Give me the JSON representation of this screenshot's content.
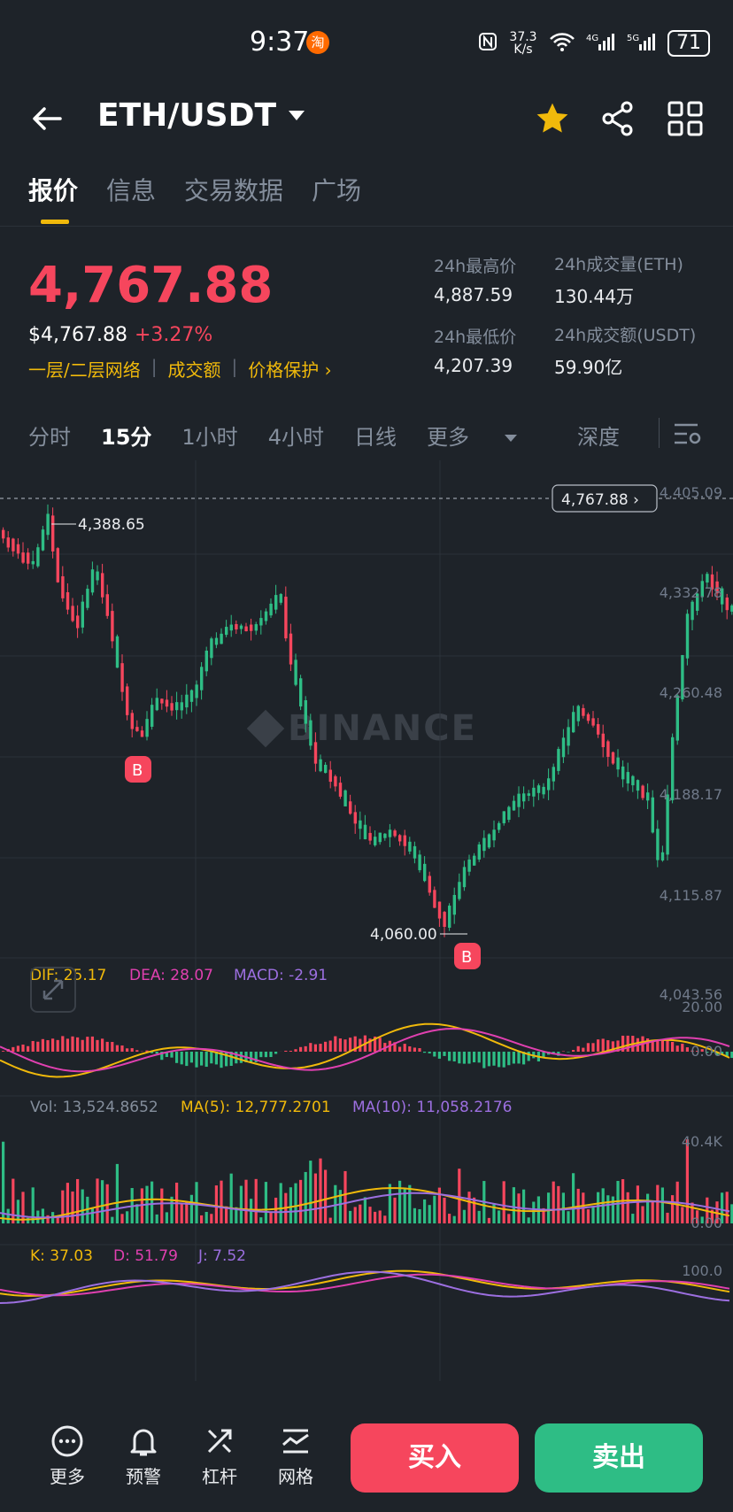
{
  "status_bar": {
    "time": "9:37",
    "net_speed": "37.3 K/s",
    "battery": "71",
    "app_badge": "淘"
  },
  "header": {
    "pair": "ETH/USDT",
    "icons": [
      "back-arrow-icon",
      "star-icon",
      "share-icon",
      "grid-menu-icon"
    ],
    "star_color": "#f0b90b"
  },
  "tabs": [
    {
      "label": "报价",
      "active": true
    },
    {
      "label": "信息"
    },
    {
      "label": "交易数据"
    },
    {
      "label": "广场"
    }
  ],
  "price": {
    "last": "4,767.88",
    "usd": "$4,767.88",
    "change": "+3.27%",
    "color": "#f6465d"
  },
  "links": {
    "network": "一层/二层网络",
    "volume": "成交额",
    "protection": "价格保护 ›"
  },
  "stats": {
    "high_label": "24h最高价",
    "high": "4,887.59",
    "vol_eth_label": "24h成交量(ETH)",
    "vol_eth": "130.44万",
    "low_label": "24h最低价",
    "low": "4,207.39",
    "vol_usdt_label": "24h成交额(USDT)",
    "vol_usdt": "59.90亿"
  },
  "timeframes": {
    "t1": "分时",
    "t2": "15分",
    "t3": "1小时",
    "t4": "4小时",
    "t5": "日线",
    "more": "更多",
    "depth": "深度",
    "active": "15分"
  },
  "chart": {
    "watermark": "BINANCE",
    "y_ticks": [
      "4,405.09",
      "4,332.78",
      "4,260.48",
      "4,188.17",
      "4,115.87",
      "4,043.56"
    ],
    "last_price_tag": "4,767.88 ›",
    "high_marker": "4,388.65",
    "low_marker": "4,060.00",
    "buy_marker": "B",
    "macd": {
      "dif": "DIF: 25.17",
      "dea": "DEA: 28.07",
      "macd": "MACD: -2.91",
      "ticks": [
        "20.00",
        "0.00"
      ]
    },
    "volume": {
      "vol": "Vol: 13,524.8652",
      "ma5": "MA(5): 12,777.2701",
      "ma10": "MA(10): 11,058.2176",
      "ticks": [
        "40.4K",
        "0.00"
      ]
    },
    "kdj": {
      "k": "K: 37.03",
      "d": "D: 51.79",
      "j": "J: 7.52",
      "tick": "100.0"
    },
    "colors": {
      "up": "#2ebd85",
      "down": "#f6465d",
      "dif": "#f0b90b",
      "dea": "#e040b0",
      "macd": "#9c6fe0"
    }
  },
  "bottom": {
    "more": "更多",
    "alert": "预警",
    "leverage": "杠杆",
    "grid": "网格",
    "buy": "买入",
    "sell": "卖出"
  }
}
